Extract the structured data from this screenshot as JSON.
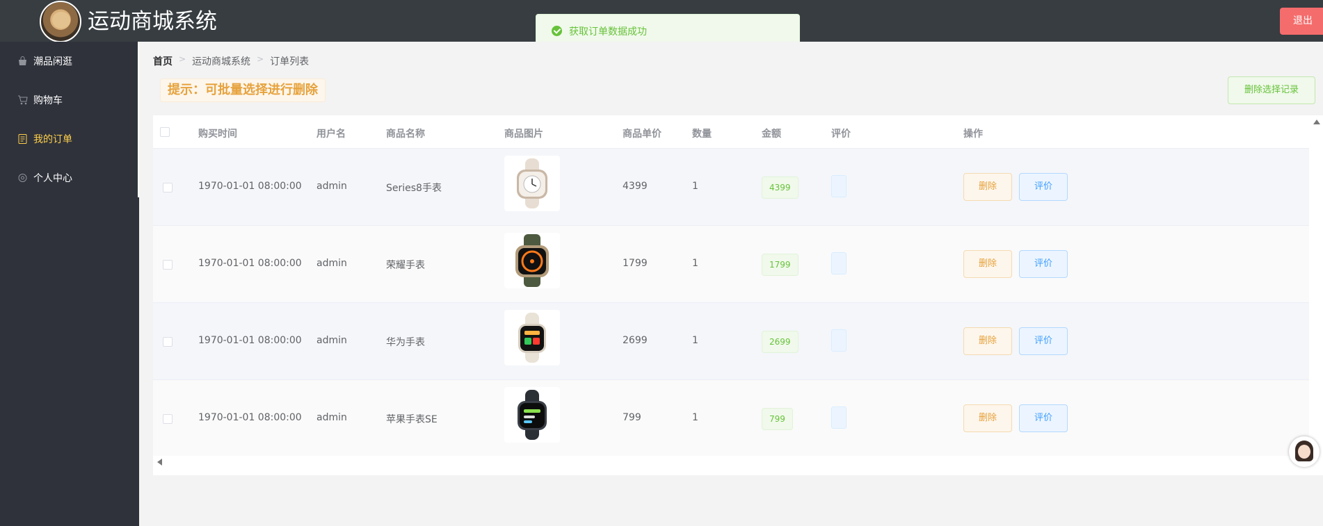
{
  "header": {
    "title": "运动商城系统",
    "logout_label": "退出"
  },
  "toast": {
    "message": "获取订单数据成功"
  },
  "sidebar": {
    "items": [
      {
        "label": "潮品闲逛",
        "icon": "bag-icon",
        "active": false
      },
      {
        "label": "购物车",
        "icon": "cart-icon",
        "active": false
      },
      {
        "label": "我的订单",
        "icon": "document-icon",
        "active": true
      },
      {
        "label": "个人中心",
        "icon": "gear-icon",
        "active": false
      }
    ]
  },
  "breadcrumb": [
    "首页",
    "运动商城系统",
    "订单列表"
  ],
  "tip": "提示：可批量选择进行删除",
  "batch_delete_label": "删除选择记录",
  "table": {
    "headers": [
      "购买时间",
      "用户名",
      "商品名称",
      "商品图片",
      "商品单价",
      "数量",
      "金额",
      "评价",
      "操作"
    ],
    "rows": [
      {
        "time": "1970-01-01 08:00:00",
        "user": "admin",
        "product": "Series8手表",
        "image": "starlight-watch-image",
        "price": "4399",
        "qty": "1",
        "amount": "4399",
        "delete_label": "删除",
        "rate_label": "评价"
      },
      {
        "time": "1970-01-01 08:00:00",
        "user": "admin",
        "product": "荣耀手表",
        "image": "orange-ultra-watch-image",
        "price": "1799",
        "qty": "1",
        "amount": "1799",
        "delete_label": "删除",
        "rate_label": "评价"
      },
      {
        "time": "1970-01-01 08:00:00",
        "user": "admin",
        "product": "华为手表",
        "image": "cream-watch-image",
        "price": "2699",
        "qty": "1",
        "amount": "2699",
        "delete_label": "删除",
        "rate_label": "评价"
      },
      {
        "time": "1970-01-01 08:00:00",
        "user": "admin",
        "product": "苹果手表SE",
        "image": "midnight-watch-image",
        "price": "799",
        "qty": "1",
        "amount": "799",
        "delete_label": "删除",
        "rate_label": "评价"
      }
    ]
  },
  "colors": {
    "header_bg": "#373d41",
    "sidebar_bg": "#2f323b",
    "active_menu": "#ffd04b",
    "success": "#67c23a",
    "warning": "#e6a23c",
    "primary": "#409eff",
    "danger": "#f56c6c"
  }
}
